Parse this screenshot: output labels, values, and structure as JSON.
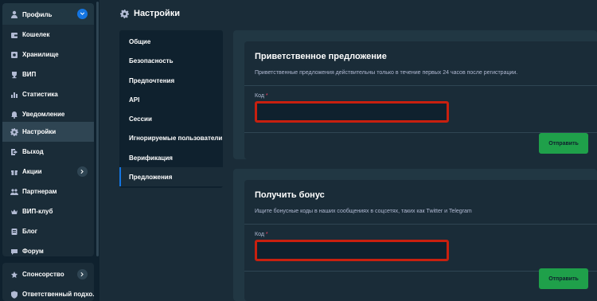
{
  "sidebar": {
    "profile": {
      "label": "Профиль",
      "icon": "user-icon"
    },
    "items": [
      {
        "label": "Кошелек",
        "icon": "wallet-icon"
      },
      {
        "label": "Хранилище",
        "icon": "vault-icon"
      },
      {
        "label": "ВИП",
        "icon": "trophy-icon"
      },
      {
        "label": "Статистика",
        "icon": "stats-icon"
      },
      {
        "label": "Уведомление",
        "icon": "bell-icon"
      },
      {
        "label": "Настройки",
        "icon": "gear-icon",
        "active": true
      },
      {
        "label": "Выход",
        "icon": "logout-icon"
      },
      {
        "label": "Акции",
        "icon": "gift-icon"
      },
      {
        "label": "Партнерам",
        "icon": "partners-icon"
      },
      {
        "label": "ВИП-клуб",
        "icon": "crown-icon"
      },
      {
        "label": "Блог",
        "icon": "blog-icon"
      },
      {
        "label": "Форум",
        "icon": "forum-icon"
      }
    ],
    "bottom": [
      {
        "label": "Спонсорство",
        "icon": "sponsor-icon"
      },
      {
        "label": "Ответственный подхо...",
        "icon": "shield-icon"
      }
    ]
  },
  "header": {
    "title": "Настройки",
    "icon": "gear-icon"
  },
  "settings_nav": [
    "Общие",
    "Безопасность",
    "Предпочтения",
    "API",
    "Сессии",
    "Игнорируемые пользователи",
    "Верификация",
    "Предложения"
  ],
  "welcome_offer": {
    "title": "Приветственное предложение",
    "description": "Приветственные предложения действительны только в течение первых 24 часов после регистрации.",
    "code_label": "Код",
    "required_mark": "*",
    "code_value": "",
    "submit_label": "Отправить"
  },
  "bonus": {
    "title": "Получить бонус",
    "description": "Ищите бонусные коды в наших сообщениях в соцсетях, таких как Twitter и Telegram",
    "code_label": "Код",
    "required_mark": "*",
    "code_value": "",
    "submit_label": "Отправить"
  },
  "colors": {
    "background": "#1a2c38",
    "sidebar": "#0f212e",
    "card": "#213743",
    "accent_blue": "#1475e1",
    "submit_green": "#1fa04a",
    "highlight_red": "#c8200f"
  }
}
